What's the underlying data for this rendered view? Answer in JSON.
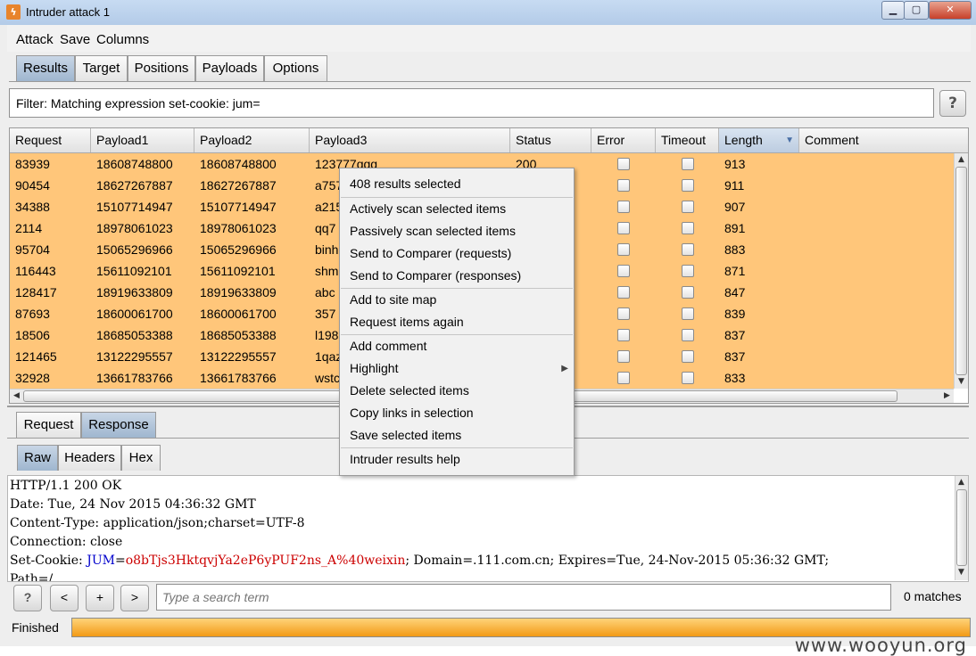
{
  "window": {
    "title": "Intruder attack 1"
  },
  "menubar": [
    "Attack",
    "Save",
    "Columns"
  ],
  "tabs": [
    "Results",
    "Target",
    "Positions",
    "Payloads",
    "Options"
  ],
  "filter": {
    "text": "Filter: Matching expression set-cookie: jum=",
    "help": "?"
  },
  "table": {
    "columns": [
      "Request",
      "Payload1",
      "Payload2",
      "Payload3",
      "Status",
      "Error",
      "Timeout",
      "Length",
      "Comment"
    ],
    "rows": [
      {
        "request": "83939",
        "p1": "18608748800",
        "p2": "18608748800",
        "p3": "123777qqq",
        "status": "200",
        "length": "913"
      },
      {
        "request": "90454",
        "p1": "18627267887",
        "p2": "18627267887",
        "p3": "a757",
        "status": "",
        "length": "911"
      },
      {
        "request": "34388",
        "p1": "15107714947",
        "p2": "15107714947",
        "p3": "a215",
        "status": "",
        "length": "907"
      },
      {
        "request": "2114",
        "p1": "18978061023",
        "p2": "18978061023",
        "p3": "qq7",
        "status": "",
        "length": "891"
      },
      {
        "request": "95704",
        "p1": "15065296966",
        "p2": "15065296966",
        "p3": "binh",
        "status": "",
        "length": "883"
      },
      {
        "request": "116443",
        "p1": "15611092101",
        "p2": "15611092101",
        "p3": "shm",
        "status": "",
        "length": "871"
      },
      {
        "request": "128417",
        "p1": "18919633809",
        "p2": "18919633809",
        "p3": "abc",
        "status": "",
        "length": "847"
      },
      {
        "request": "87693",
        "p1": "18600061700",
        "p2": "18600061700",
        "p3": "357",
        "status": "",
        "length": "839"
      },
      {
        "request": "18506",
        "p1": "18685053388",
        "p2": "18685053388",
        "p3": "l198",
        "status": "",
        "length": "837"
      },
      {
        "request": "121465",
        "p1": "13122295557",
        "p2": "13122295557",
        "p3": "1qaz",
        "status": "",
        "length": "837"
      },
      {
        "request": "32928",
        "p1": "13661783766",
        "p2": "13661783766",
        "p3": "wstc",
        "status": "",
        "length": "833"
      }
    ]
  },
  "context_menu": {
    "header": "408 results selected",
    "groups": [
      [
        "Actively scan selected items",
        "Passively scan selected items",
        "Send to Comparer (requests)",
        "Send to Comparer (responses)"
      ],
      [
        "Add to site map",
        "Request items again"
      ],
      [
        "Add comment",
        "Highlight",
        "Delete selected items",
        "Copy links in selection",
        "Save selected items"
      ],
      [
        "Intruder results help"
      ]
    ],
    "submenu_arrow": "▶"
  },
  "reqres_tabs": [
    "Request",
    "Response"
  ],
  "view_tabs": [
    "Raw",
    "Headers",
    "Hex"
  ],
  "response": {
    "lines": [
      "HTTP/1.1 200 OK",
      "Date: Tue, 24 Nov 2015 04:36:32 GMT",
      "Content-Type: application/json;charset=UTF-8",
      "Connection: close"
    ],
    "cookie_prefix": "Set-Cookie: ",
    "cookie_name": "JUM",
    "cookie_eq": "=",
    "cookie_value": "o8bTjs3HktqvjYa2eP6yPUF2ns_A%40weixin",
    "cookie_rest": "; Domain=.111.com.cn; Expires=Tue, 24-Nov-2015 05:36:32 GMT;",
    "path_line": "Path=/"
  },
  "searchbar": {
    "help": "?",
    "prev": "<",
    "add": "+",
    "next": ">",
    "placeholder": "Type a search term",
    "matches": "0 matches"
  },
  "status": {
    "text": "Finished",
    "progress": 1.0
  },
  "watermark": "www.wooyun.org",
  "colors": {
    "selected_row": "#ffc67a",
    "progress": "#f29a16",
    "cookie_name": "#0000cc",
    "cookie_value": "#cc0000"
  }
}
